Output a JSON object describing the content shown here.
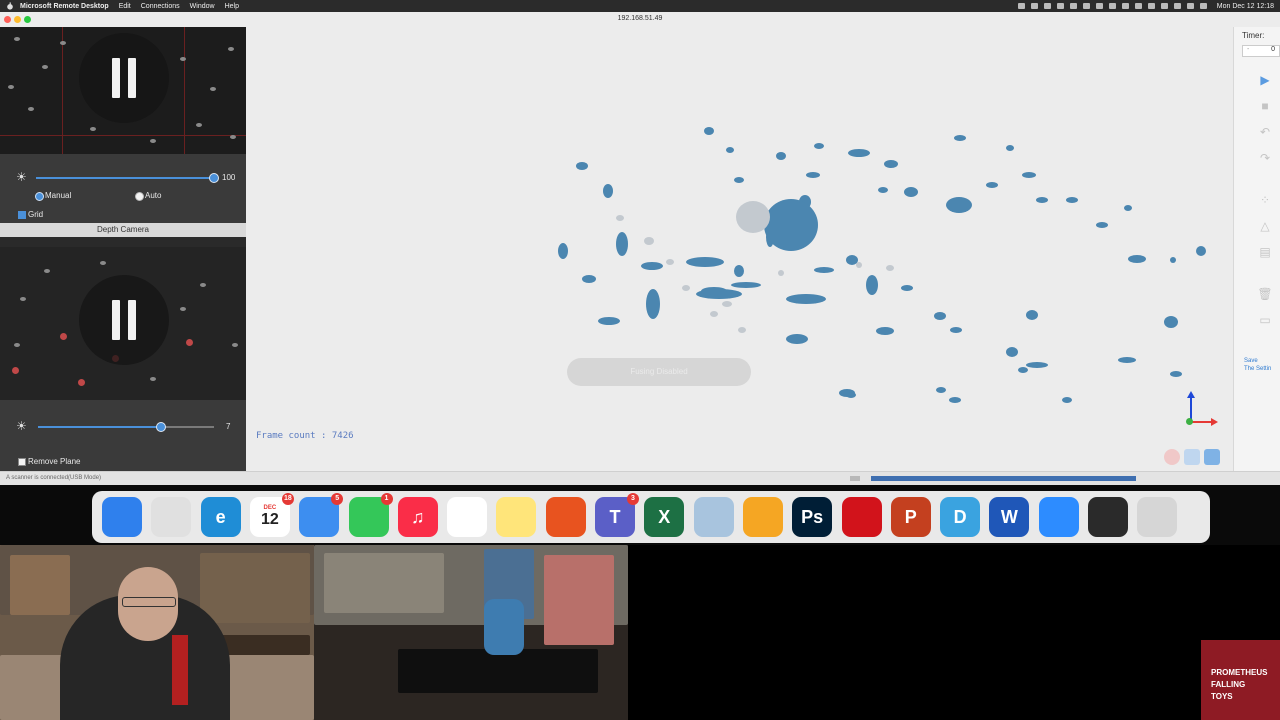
{
  "menubar": {
    "app_name": "Microsoft Remote Desktop",
    "items": [
      "Edit",
      "Connections",
      "Window",
      "Help"
    ],
    "clock": "Mon Dec 12 12:18"
  },
  "window": {
    "title": "192.168.51.49"
  },
  "left_panel": {
    "color_camera": {
      "brightness_value": "100",
      "brightness_level": 1.0,
      "mode_manual": "Manual",
      "mode_auto": "Auto",
      "grid_label": "Grid"
    },
    "depth_camera": {
      "header": "Depth Camera",
      "range_value": "7",
      "range_level": 0.7,
      "remove_plane_label": "Remove Plane"
    }
  },
  "viewport": {
    "frame_count": "Frame count : 7426",
    "toast": "Fusing Disabled"
  },
  "right_panel": {
    "timer_label": "Timer:",
    "timer_value": "0",
    "save_line1": "Save",
    "save_line2": "The Settin"
  },
  "statusbar": {
    "status_text": "A scanner is connected(USB Mode)"
  },
  "dock": {
    "items": [
      {
        "name": "finder",
        "label": "",
        "color": "#2f80ed"
      },
      {
        "name": "launchpad",
        "label": "",
        "color": "#e0e0e0"
      },
      {
        "name": "edge",
        "label": "e",
        "color": "#1f8dd6"
      },
      {
        "name": "calendar",
        "label": "12",
        "color": "#ffffff"
      },
      {
        "name": "mail",
        "label": "",
        "color": "#3d8ef0"
      },
      {
        "name": "messages",
        "label": "",
        "color": "#34c759"
      },
      {
        "name": "music",
        "label": "♫",
        "color": "#fa2d48"
      },
      {
        "name": "photos",
        "label": "",
        "color": "#ffffff"
      },
      {
        "name": "notes",
        "label": "",
        "color": "#ffe57a"
      },
      {
        "name": "remote-desktop",
        "label": "",
        "color": "#e8531f"
      },
      {
        "name": "teams",
        "label": "T",
        "color": "#5b5fc7"
      },
      {
        "name": "excel",
        "label": "X",
        "color": "#1d7044"
      },
      {
        "name": "preview",
        "label": "",
        "color": "#a8c4de"
      },
      {
        "name": "pinwheel",
        "label": "",
        "color": "#f5a623"
      },
      {
        "name": "photoshop",
        "label": "Ps",
        "color": "#001e36"
      },
      {
        "name": "acrobat",
        "label": "",
        "color": "#d2131b"
      },
      {
        "name": "powerpoint",
        "label": "P",
        "color": "#c4401f"
      },
      {
        "name": "app-d",
        "label": "D",
        "color": "#3aa3e0"
      },
      {
        "name": "word",
        "label": "W",
        "color": "#1f57b8"
      },
      {
        "name": "zoom",
        "label": "",
        "color": "#2d8cff"
      },
      {
        "name": "obs",
        "label": "",
        "color": "#2a2a2a"
      },
      {
        "name": "trash",
        "label": "",
        "color": "#d6d6d6"
      }
    ],
    "calendar_month": "DEC",
    "badges": {
      "calendar": "18",
      "mail": "5",
      "messages": "1",
      "teams": "3"
    }
  },
  "overlay": {
    "promo_lines": [
      "PROMETHEUS",
      "FALLING",
      "TOYS"
    ]
  }
}
